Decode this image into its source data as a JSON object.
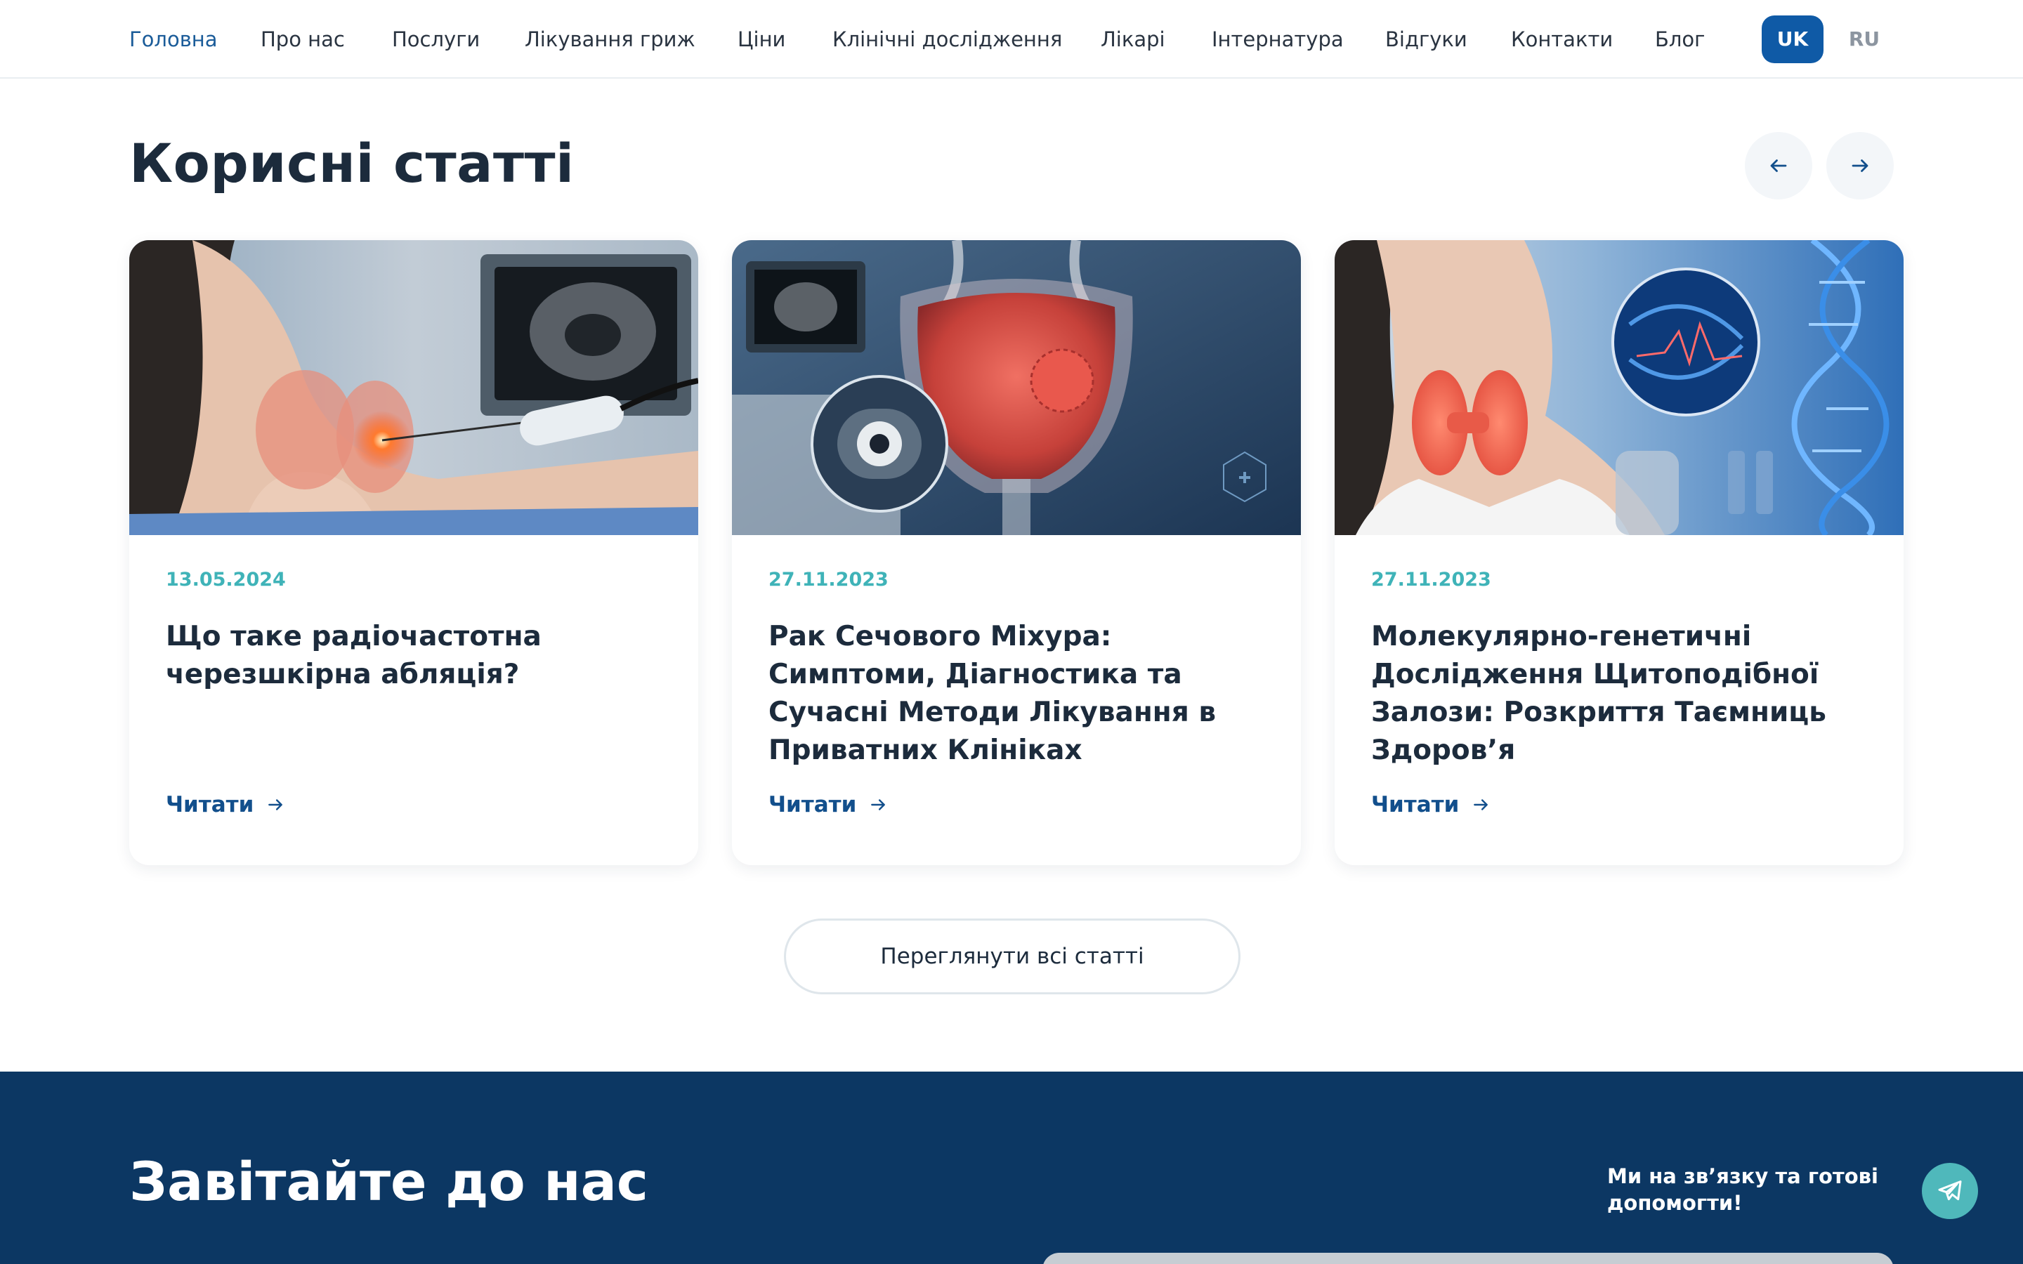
{
  "nav": {
    "items": [
      {
        "label": "Головна",
        "active": true
      },
      {
        "label": "Про нас"
      },
      {
        "label": "Послуги"
      },
      {
        "label": "Лікування гриж"
      },
      {
        "label": "Ціни"
      },
      {
        "label": "Клінічні дослідження"
      },
      {
        "label": "Лікарі"
      },
      {
        "label": "Інтернатура"
      },
      {
        "label": "Відгуки"
      },
      {
        "label": "Контакти"
      },
      {
        "label": "Блог"
      }
    ],
    "languages": [
      {
        "code": "UK",
        "active": true
      },
      {
        "code": "RU",
        "active": false
      }
    ]
  },
  "articles": {
    "title": "Корисні статті",
    "prev_icon": "arrow-left-icon",
    "next_icon": "arrow-right-icon",
    "cards": [
      {
        "date": "13.05.2024",
        "title": "Що таке радіочастотна черезшкірна абляція?",
        "link_label": "Читати",
        "image": "thyroid-ablation-photo"
      },
      {
        "date": "27.11.2023",
        "title": "Рак Сечового Міхура: Симптоми, Діагностика та Сучасні Методи Лікування в Приватних Клініках",
        "link_label": "Читати",
        "image": "bladder-illustration"
      },
      {
        "date": "27.11.2023",
        "title": "Молекулярно-генетичні Дослідження Щитоподібної Залози: Розкриття Таємниць Здоров’я",
        "link_label": "Читати",
        "image": "thyroid-dna-photo"
      }
    ],
    "view_all_label": "Переглянути всі статті"
  },
  "visit": {
    "title": "Завітайте до нас",
    "tagline": "Ми на зв’язку та готові допомогти!"
  },
  "colors": {
    "primary": "#0f5aa6",
    "dark_navy": "#0c3763",
    "accent_teal": "#3fb3b8",
    "text": "#1c2b3c"
  }
}
